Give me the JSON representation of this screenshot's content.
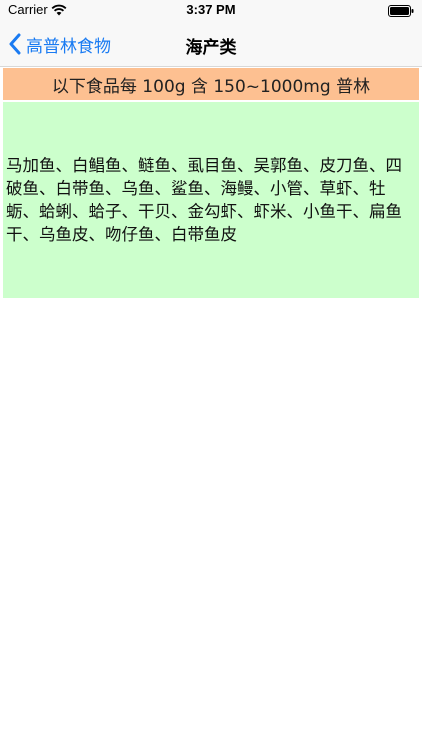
{
  "status_bar": {
    "carrier": "Carrier",
    "time": "3:37 PM",
    "wifi_icon": "wifi-icon",
    "battery_icon": "battery-icon"
  },
  "nav": {
    "back_label": "高普林食物",
    "back_icon": "chevron-left-icon",
    "title": "海产类",
    "accent_color": "#1a7bf2"
  },
  "content": {
    "header": "以下食品每 100g 含 150~1000mg 普林",
    "header_color": "#fdc091",
    "foods": "马加鱼、白鲳鱼、鲢鱼、虱目鱼、吴郭鱼、皮刀鱼、四破鱼、白带鱼、乌鱼、鲨鱼、海鳗、小管、草虾、牡蛎、蛤蜊、蛤子、干贝、金勾虾、虾米、小鱼干、扁鱼干、乌鱼皮、吻仔鱼、白带鱼皮",
    "panel_color": "#ccffcc"
  }
}
